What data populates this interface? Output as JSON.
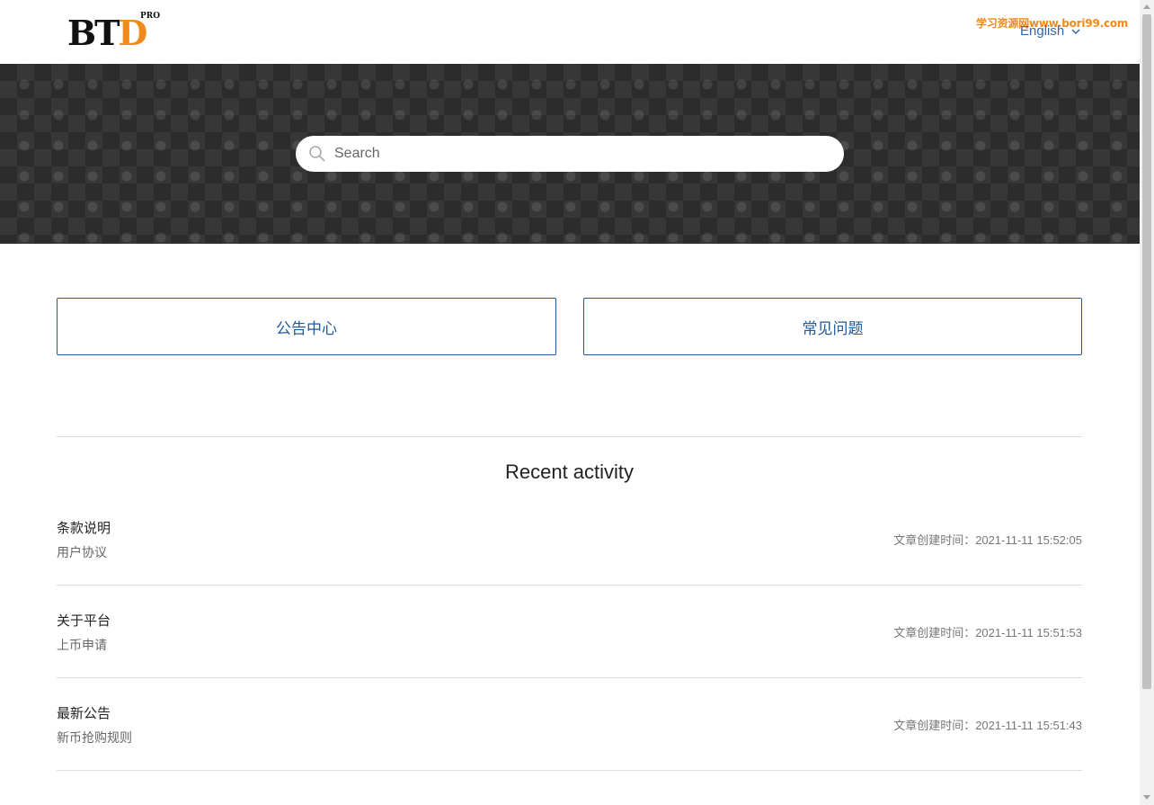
{
  "header": {
    "logo_main": "BT",
    "logo_accent": "D",
    "logo_badge": "PRO",
    "watermark": "学习资源网www.bori99.com",
    "language": "English"
  },
  "search": {
    "placeholder": "Search"
  },
  "categories": [
    {
      "label": "公告中心"
    },
    {
      "label": "常见问题"
    }
  ],
  "recent": {
    "title": "Recent activity",
    "items": [
      {
        "title": "条款说明",
        "subtitle": "用户协议",
        "time": "文章创建时间：2021-11-11 15:52:05"
      },
      {
        "title": "关于平台",
        "subtitle": "上币申请",
        "time": "文章创建时间：2021-11-11 15:51:53"
      },
      {
        "title": "最新公告",
        "subtitle": "新币抢购规则",
        "time": "文章创建时间：2021-11-11 15:51:43"
      }
    ]
  },
  "colors": {
    "accent": "#1f5a99",
    "logo_orange": "#f08a1a",
    "hero_bg": "#2c2c2c"
  }
}
